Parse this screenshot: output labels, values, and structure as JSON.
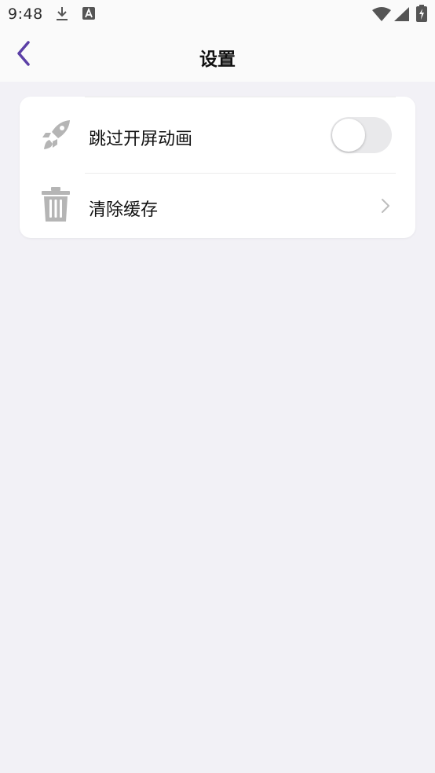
{
  "status_bar": {
    "time": "9:48",
    "icons": [
      "download-icon",
      "a-notification-icon",
      "wifi-icon",
      "signal-icon",
      "battery-icon"
    ]
  },
  "nav": {
    "title": "设置",
    "back_icon": "chevron-left-icon",
    "accent_color": "#5b3fa6"
  },
  "settings": {
    "items": [
      {
        "icon": "rocket-icon",
        "label": "跳过开屏动画",
        "control": "toggle",
        "toggle_on": false
      },
      {
        "icon": "trash-icon",
        "label": "清除缓存",
        "control": "chevron-right-icon"
      }
    ]
  }
}
